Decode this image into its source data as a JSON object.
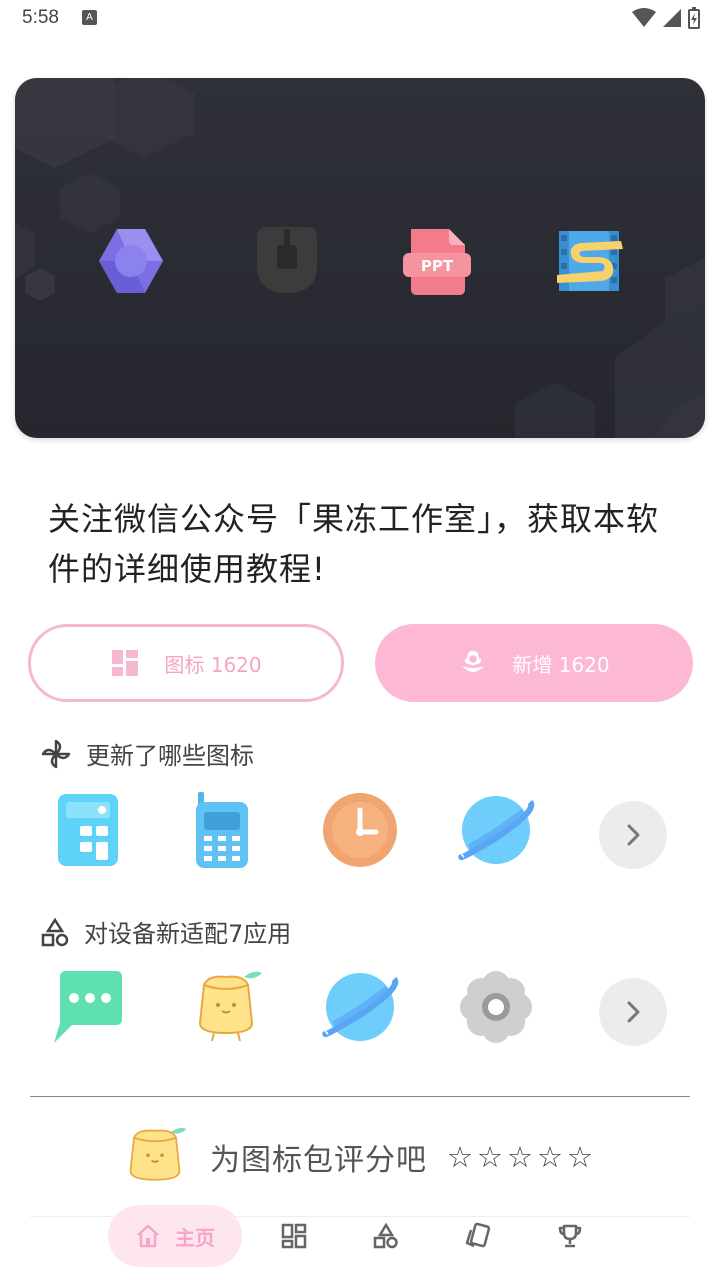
{
  "status": {
    "time": "5:58",
    "notif_letter": "A"
  },
  "banner": {
    "icons": [
      "hexagon-app-icon",
      "mouse-icon",
      "ppt-file-icon",
      "film-s-icon"
    ],
    "ppt_label": "PPT"
  },
  "intro": {
    "text": "关注微信公众号「果冻工作室」，获取本软件的详细使用教程!"
  },
  "buttons": {
    "icons_label": "图标 1620",
    "new_label": "新增 1620"
  },
  "sections": {
    "updated": {
      "title": "更新了哪些图标",
      "icons": [
        "calculator-icon",
        "phone-icon",
        "clock-icon",
        "planet-icon"
      ]
    },
    "adapted": {
      "title": "对设备新适配7应用",
      "icons": [
        "message-icon",
        "jelly-mascot-icon",
        "planet-icon",
        "settings-flower-icon"
      ]
    }
  },
  "rate": {
    "text": "为图标包评分吧",
    "stars": [
      "☆",
      "☆",
      "☆",
      "☆",
      "☆"
    ]
  },
  "nav": {
    "home_label": "主页",
    "items": [
      "home-icon",
      "grid-icon",
      "shapes-icon",
      "cards-icon",
      "trophy-icon"
    ]
  },
  "colors": {
    "accent_pink": "#fdb8d6",
    "banner_bg": "#2b2c33"
  }
}
